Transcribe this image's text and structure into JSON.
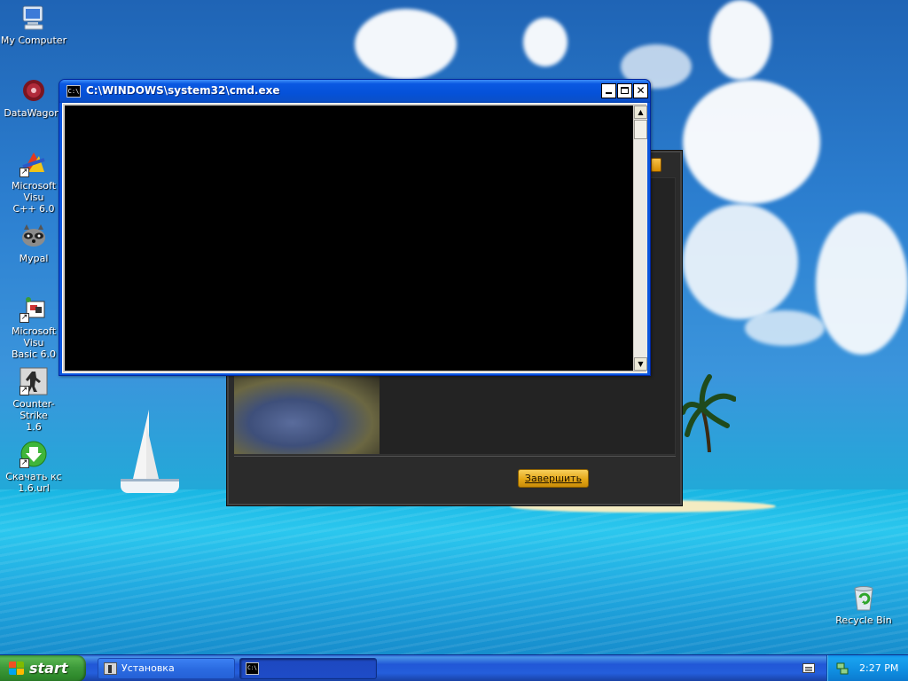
{
  "desktop": {
    "icons": [
      {
        "label": "My Computer",
        "icon": "my-computer-icon"
      },
      {
        "label": "DataWagon.",
        "icon": "datawagon-icon"
      },
      {
        "label": "Microsoft Visu C++ 6.0",
        "line1": "Microsoft Visu",
        "line2": "C++ 6.0",
        "icon": "visual-cpp-icon"
      },
      {
        "label": "Mypal",
        "icon": "mypal-raccoon-icon"
      },
      {
        "label": "Microsoft Visu Basic 6.0",
        "line1": "Microsoft Visu",
        "line2": "Basic 6.0",
        "icon": "visual-basic-icon"
      },
      {
        "label": "Counter-Strike 1.6",
        "line1": "Counter-Strike",
        "line2": "1.6",
        "icon": "counter-strike-icon"
      },
      {
        "label": "Скачать кс 1.6.url",
        "line1": "Скачать кс",
        "line2": "1.6.url",
        "icon": "download-arrow-icon"
      },
      {
        "label": "Recycle Bin",
        "icon": "recycle-bin-icon"
      }
    ]
  },
  "cmd_window": {
    "title": "C:\\WINDOWS\\system32\\cmd.exe",
    "icon_text": "C:\\",
    "console_text": ""
  },
  "installer_window": {
    "finish_button": "Завершить"
  },
  "taskbar": {
    "start_label": "start",
    "tasks": [
      {
        "label": "Установка",
        "state": "inactive"
      },
      {
        "label": "",
        "state": "active"
      }
    ],
    "clock": "2:27 PM"
  },
  "colors": {
    "xp_blue_title": "#0a58e2",
    "start_green": "#3e9a3b",
    "installer_bg": "#2b2b2b",
    "finish_button": "#e4a818"
  }
}
